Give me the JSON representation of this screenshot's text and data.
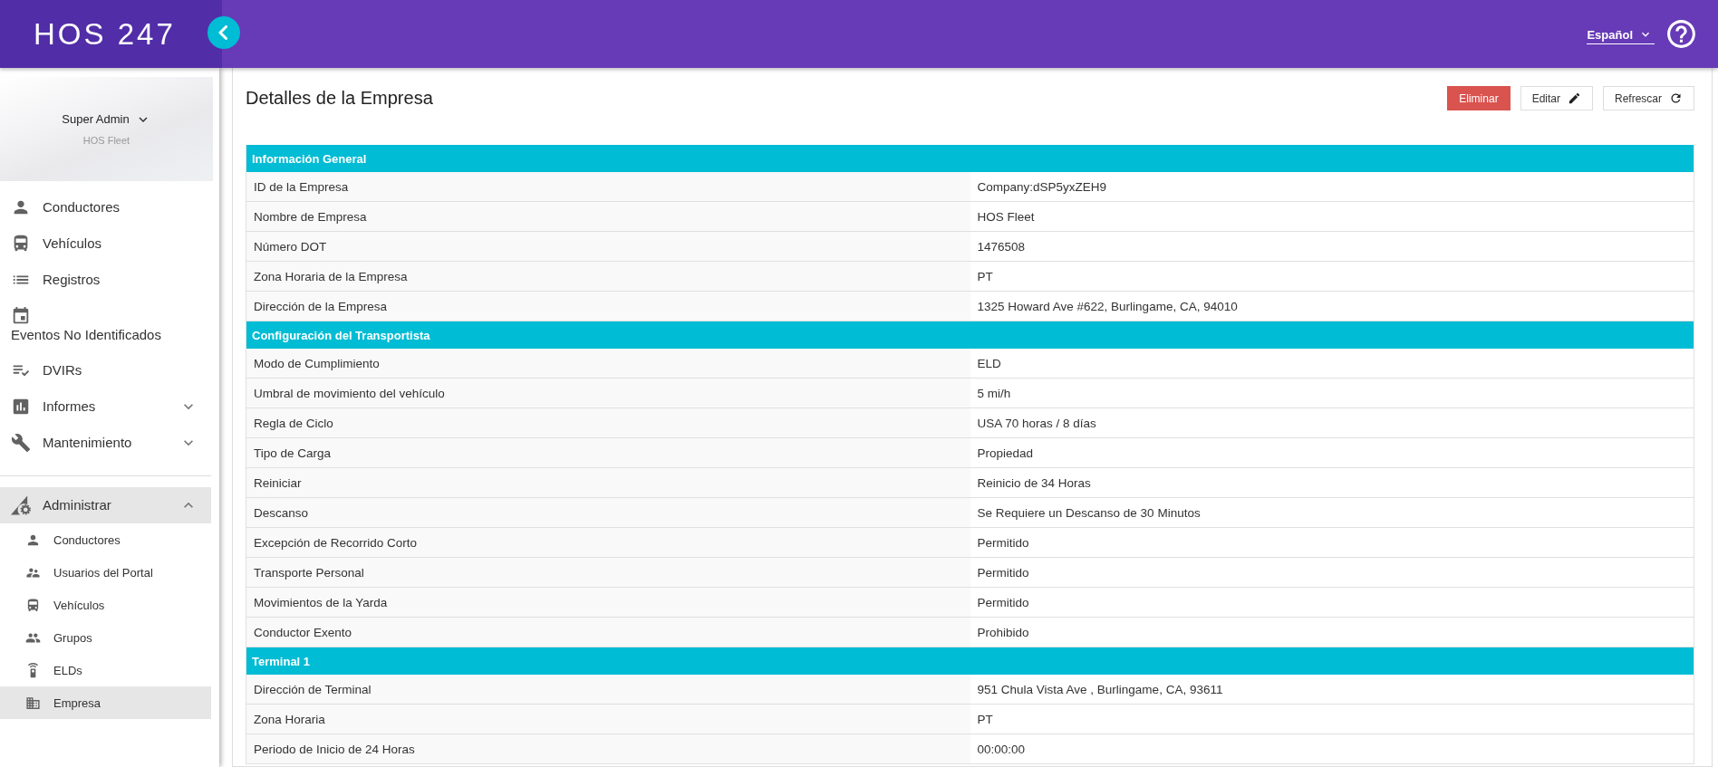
{
  "header": {
    "logo": "HOS 247",
    "language": "Español"
  },
  "sidebar": {
    "profile": {
      "name": "Super Admin",
      "company": "HOS Fleet"
    },
    "menus": [
      {
        "items": [
          {
            "kind": "link",
            "label": "Conductores",
            "selected": false
          },
          {
            "kind": "link",
            "label": "Vehículos",
            "selected": false
          },
          {
            "kind": "link",
            "label": "Registros",
            "selected": false
          },
          {
            "kind": "link",
            "label": "Eventos No Identificados",
            "selected": false
          },
          {
            "kind": "link",
            "label": "DVIRs",
            "selected": false
          },
          {
            "kind": "group",
            "label": "Informes",
            "selected": false,
            "expanded": false
          },
          {
            "kind": "group",
            "label": "Mantenimiento",
            "selected": false,
            "expanded": false
          }
        ]
      },
      {
        "items": [
          {
            "kind": "group",
            "label": "Administrar",
            "selected": true,
            "expanded": true,
            "children": [
              {
                "label": "Conductores",
                "selected": false
              },
              {
                "label": "Usuarios del Portal",
                "selected": false
              },
              {
                "label": "Vehículos",
                "selected": false
              },
              {
                "label": "Grupos",
                "selected": false
              },
              {
                "label": "ELDs",
                "selected": false
              },
              {
                "label": "Empresa",
                "selected": true
              }
            ]
          }
        ]
      }
    ]
  },
  "page": {
    "title": "Detalles de la Empresa",
    "buttons": [
      {
        "kind": "danger",
        "label": "Eliminar"
      },
      {
        "kind": "edit",
        "label": "Editar"
      },
      {
        "kind": "refresh",
        "label": "Refrescar"
      }
    ]
  },
  "sections": [
    {
      "title": "Información General",
      "rows": [
        {
          "label": "ID de la Empresa",
          "value": "Company:dSP5yxZEH9"
        },
        {
          "label": "Nombre de Empresa",
          "value": "HOS Fleet"
        },
        {
          "label": "Número DOT",
          "value": "1476508"
        },
        {
          "label": "Zona Horaria de la Empresa",
          "value": "PT"
        },
        {
          "label": "Dirección de la Empresa",
          "value": "1325 Howard Ave #622, Burlingame, CA, 94010"
        }
      ]
    },
    {
      "title": "Configuración del Transportista",
      "rows": [
        {
          "label": "Modo de Cumplimiento",
          "value": "ELD"
        },
        {
          "label": "Umbral de movimiento del vehículo",
          "value": "5 mi/h"
        },
        {
          "label": "Regla de Ciclo",
          "value": "USA 70 horas / 8 días"
        },
        {
          "label": "Tipo de Carga",
          "value": "Propiedad"
        },
        {
          "label": "Reiniciar",
          "value": "Reinicio de 34 Horas"
        },
        {
          "label": "Descanso",
          "value": "Se Requiere un Descanso de 30 Minutos"
        },
        {
          "label": "Excepción de Recorrido Corto",
          "value": "Permitido"
        },
        {
          "label": "Transporte Personal",
          "value": "Permitido"
        },
        {
          "label": "Movimientos de la Yarda",
          "value": "Permitido"
        },
        {
          "label": "Conductor Exento",
          "value": "Prohibido"
        }
      ]
    },
    {
      "title": "Terminal 1",
      "rows": [
        {
          "label": "Dirección de Terminal",
          "value": "951 Chula Vista Ave , Burlingame, CA, 93611"
        },
        {
          "label": "Zona Horaria",
          "value": "PT"
        },
        {
          "label": "Periodo de Inicio de 24 Horas",
          "value": "00:00:00"
        }
      ]
    }
  ]
}
